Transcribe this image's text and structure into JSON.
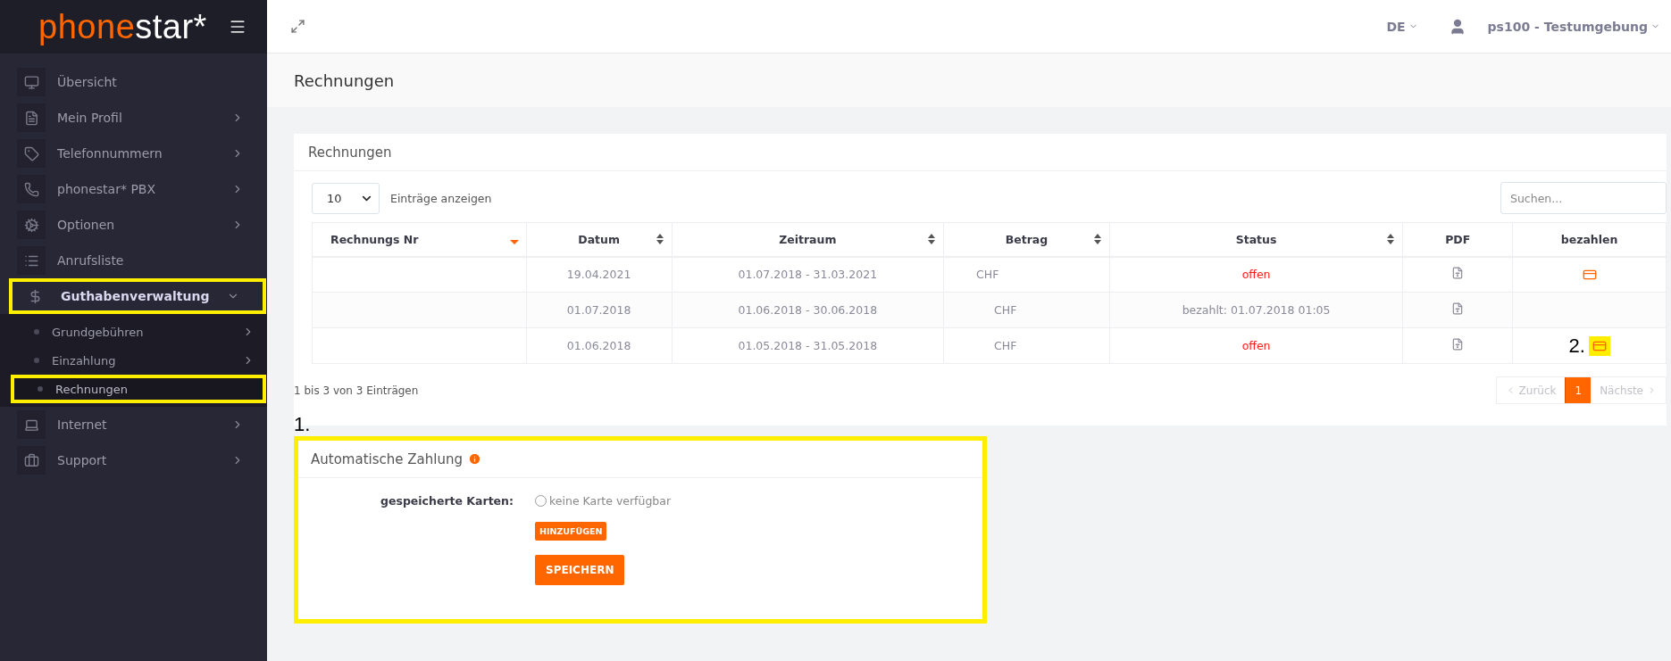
{
  "sidebar": {
    "logo": {
      "first": "phone",
      "second": "star*"
    },
    "items": [
      {
        "label": "Übersicht",
        "has_submenu": false,
        "expanded": false,
        "highlighted": false
      },
      {
        "label": "Mein Profil",
        "has_submenu": true,
        "expanded": false,
        "highlighted": false
      },
      {
        "label": "Telefonnummern",
        "has_submenu": true,
        "expanded": false,
        "highlighted": false
      },
      {
        "label": "phonestar* PBX",
        "has_submenu": true,
        "expanded": false,
        "highlighted": false
      },
      {
        "label": "Optionen",
        "has_submenu": true,
        "expanded": false,
        "highlighted": false
      },
      {
        "label": "Anrufsliste",
        "has_submenu": false,
        "expanded": false,
        "highlighted": false
      },
      {
        "label": "Guthabenverwaltung",
        "has_submenu": true,
        "expanded": true,
        "highlighted": true,
        "children": [
          {
            "label": "Grundgebühren",
            "has_submenu": true,
            "selected": false,
            "highlighted": false
          },
          {
            "label": "Einzahlung",
            "has_submenu": true,
            "selected": false,
            "highlighted": false
          },
          {
            "label": "Rechnungen",
            "has_submenu": false,
            "selected": true,
            "highlighted": true
          }
        ]
      },
      {
        "label": "Internet",
        "has_submenu": true,
        "expanded": false,
        "highlighted": false
      },
      {
        "label": "Support",
        "has_submenu": true,
        "expanded": false,
        "highlighted": false
      }
    ]
  },
  "header": {
    "language": "DE",
    "user": "ps100 - Testumgebung"
  },
  "page_title": "Rechnungen",
  "invoices_card": {
    "title": "Rechnungen",
    "page_size": "10",
    "page_size_label": "Einträge anzeigen",
    "search": {
      "placeholder": "Suchen..."
    },
    "table": {
      "columns": [
        {
          "label": "Rechnungs Nr",
          "sortable": true,
          "sorted": true
        },
        {
          "label": "Datum",
          "sortable": true,
          "sorted": false
        },
        {
          "label": "Zeitraum",
          "sortable": true,
          "sorted": false
        },
        {
          "label": "Betrag",
          "sortable": true,
          "sorted": false
        },
        {
          "label": "Status",
          "sortable": true,
          "sorted": false
        },
        {
          "label": "PDF",
          "sortable": false
        },
        {
          "label": "bezahlen",
          "sortable": false
        }
      ],
      "rows": [
        {
          "date": "19.04.2021",
          "period": "01.07.2018 - 31.03.2021",
          "amount": "CHF",
          "status": "offen",
          "paid": false,
          "payable": true,
          "pay_highlighted": false
        },
        {
          "date": "01.07.2018",
          "period": "01.06.2018 - 30.06.2018",
          "amount": "CHF",
          "status": "bezahlt: 01.07.2018 01:05",
          "paid": true,
          "payable": false
        },
        {
          "date": "01.06.2018",
          "period": "01.05.2018 - 31.05.2018",
          "amount": "CHF",
          "status": "offen",
          "paid": false,
          "payable": true,
          "pay_highlighted": true,
          "annotation": "2."
        }
      ]
    },
    "info": "1 bis 3 von 3 Einträgen",
    "pagination": [
      {
        "label": "Zurück",
        "kind": "prev",
        "selected": false,
        "disabled": true
      },
      {
        "label": "1",
        "kind": "page",
        "selected": true,
        "disabled": false
      },
      {
        "label": "Nächste",
        "kind": "next",
        "selected": false,
        "disabled": true
      }
    ]
  },
  "annotation": "1.",
  "auto_payment": {
    "title": "Automatische Zahlung",
    "highlighted": true,
    "cards_label": "gespeicherte Karten:",
    "no_card": "keine Karte verfügbar",
    "no_card_selected": false,
    "add_button": "HINZUFÜGEN",
    "save_button": "SPEICHERN"
  }
}
